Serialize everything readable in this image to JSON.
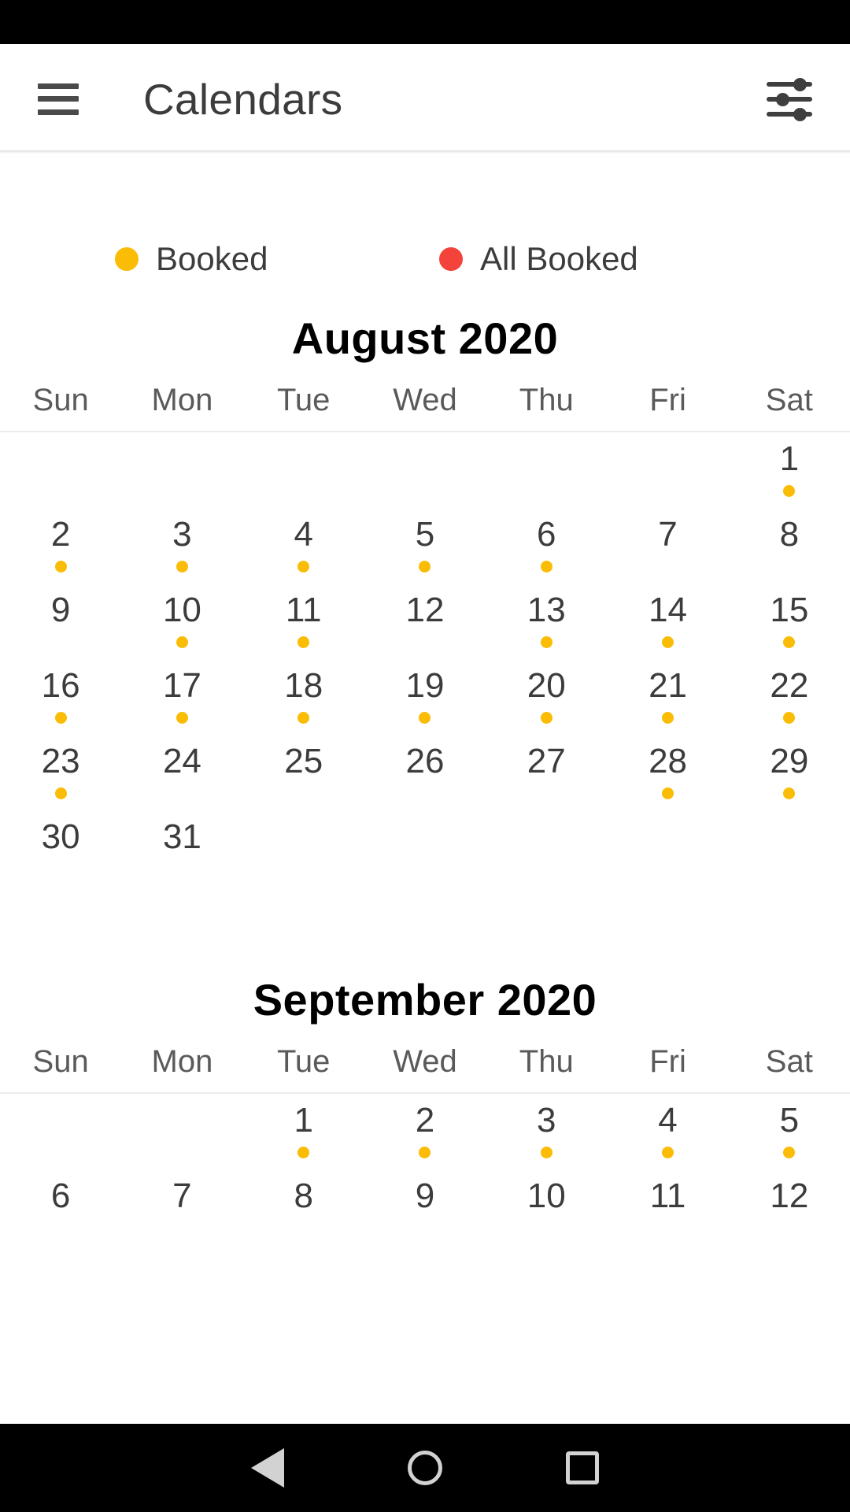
{
  "colors": {
    "booked": "#FBBC05",
    "all_booked": "#F4433B",
    "text_dark": "#3c3c3c",
    "text_gray": "#5a5a5a",
    "black": "#000000"
  },
  "app_bar": {
    "title": "Calendars",
    "menu_icon": "hamburger-icon",
    "filter_icon": "filter-sliders-icon"
  },
  "legend": [
    {
      "label": "Booked",
      "color": "#FBBC05",
      "icon": "legend-dot-yellow"
    },
    {
      "label": "All Booked",
      "color": "#F4433B",
      "icon": "legend-dot-red"
    }
  ],
  "weekdays": [
    "Sun",
    "Mon",
    "Tue",
    "Wed",
    "Thu",
    "Fri",
    "Sat"
  ],
  "months": [
    {
      "title": "August 2020",
      "weeks": [
        [
          {
            "day": "",
            "status": "none"
          },
          {
            "day": "",
            "status": "none"
          },
          {
            "day": "",
            "status": "none"
          },
          {
            "day": "",
            "status": "none"
          },
          {
            "day": "",
            "status": "none"
          },
          {
            "day": "",
            "status": "none"
          },
          {
            "day": "1",
            "status": "booked"
          }
        ],
        [
          {
            "day": "2",
            "status": "booked"
          },
          {
            "day": "3",
            "status": "booked"
          },
          {
            "day": "4",
            "status": "booked"
          },
          {
            "day": "5",
            "status": "booked"
          },
          {
            "day": "6",
            "status": "booked"
          },
          {
            "day": "7",
            "status": "none"
          },
          {
            "day": "8",
            "status": "none"
          }
        ],
        [
          {
            "day": "9",
            "status": "none"
          },
          {
            "day": "10",
            "status": "booked"
          },
          {
            "day": "11",
            "status": "booked"
          },
          {
            "day": "12",
            "status": "none"
          },
          {
            "day": "13",
            "status": "booked"
          },
          {
            "day": "14",
            "status": "booked"
          },
          {
            "day": "15",
            "status": "booked"
          }
        ],
        [
          {
            "day": "16",
            "status": "booked"
          },
          {
            "day": "17",
            "status": "booked"
          },
          {
            "day": "18",
            "status": "booked"
          },
          {
            "day": "19",
            "status": "booked"
          },
          {
            "day": "20",
            "status": "booked"
          },
          {
            "day": "21",
            "status": "booked"
          },
          {
            "day": "22",
            "status": "booked"
          }
        ],
        [
          {
            "day": "23",
            "status": "booked"
          },
          {
            "day": "24",
            "status": "none"
          },
          {
            "day": "25",
            "status": "none"
          },
          {
            "day": "26",
            "status": "none"
          },
          {
            "day": "27",
            "status": "none"
          },
          {
            "day": "28",
            "status": "booked"
          },
          {
            "day": "29",
            "status": "booked"
          }
        ],
        [
          {
            "day": "30",
            "status": "none"
          },
          {
            "day": "31",
            "status": "none"
          },
          {
            "day": "",
            "status": "none"
          },
          {
            "day": "",
            "status": "none"
          },
          {
            "day": "",
            "status": "none"
          },
          {
            "day": "",
            "status": "none"
          },
          {
            "day": "",
            "status": "none"
          }
        ]
      ]
    },
    {
      "title": "September 2020",
      "weeks": [
        [
          {
            "day": "",
            "status": "none"
          },
          {
            "day": "",
            "status": "none"
          },
          {
            "day": "1",
            "status": "booked"
          },
          {
            "day": "2",
            "status": "booked"
          },
          {
            "day": "3",
            "status": "booked"
          },
          {
            "day": "4",
            "status": "booked"
          },
          {
            "day": "5",
            "status": "booked"
          }
        ],
        [
          {
            "day": "6",
            "status": "none"
          },
          {
            "day": "7",
            "status": "none"
          },
          {
            "day": "8",
            "status": "none"
          },
          {
            "day": "9",
            "status": "none"
          },
          {
            "day": "10",
            "status": "none"
          },
          {
            "day": "11",
            "status": "none"
          },
          {
            "day": "12",
            "status": "none"
          }
        ]
      ]
    }
  ],
  "nav_bar": {
    "back": "back-triangle-icon",
    "home": "home-circle-icon",
    "recents": "recents-square-icon"
  }
}
